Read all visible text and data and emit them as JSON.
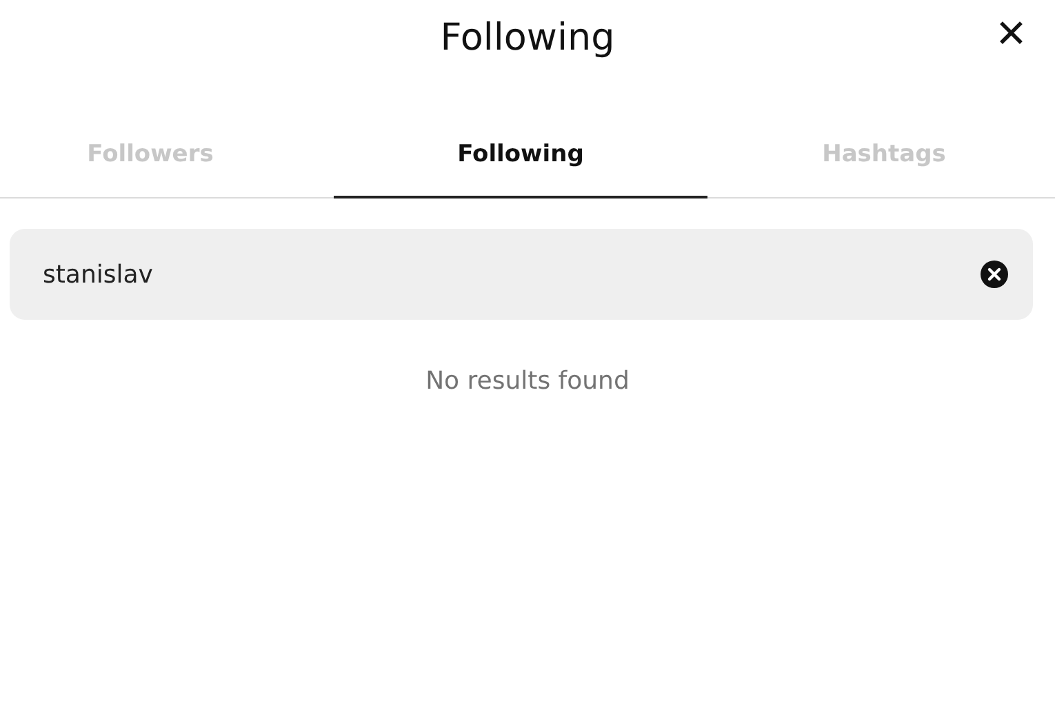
{
  "header": {
    "title": "Following",
    "close": "✕"
  },
  "tabs": [
    {
      "label": "Followers",
      "selected": false
    },
    {
      "label": "Following",
      "selected": true
    },
    {
      "label": "Hashtags",
      "selected": false
    }
  ],
  "search": {
    "value": "stanislav"
  },
  "message": "No results found"
}
